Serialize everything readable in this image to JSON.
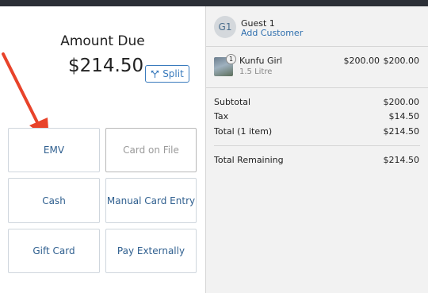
{
  "payment": {
    "amount_due_label": "Amount Due",
    "amount_due_value": "$214.50",
    "split_label": "Split",
    "methods": [
      {
        "label": "EMV",
        "enabled": true
      },
      {
        "label": "Card on File",
        "enabled": false
      },
      {
        "label": "Cash",
        "enabled": true
      },
      {
        "label": "Manual Card Entry",
        "enabled": true
      },
      {
        "label": "Gift Card",
        "enabled": true
      },
      {
        "label": "Pay Externally",
        "enabled": true
      }
    ]
  },
  "guest": {
    "initials": "G1",
    "name": "Guest 1",
    "add_customer": "Add Customer"
  },
  "cart": {
    "items": [
      {
        "qty": "1",
        "name": "Kunfu Girl",
        "variant": "1.5 Litre",
        "unit_price": "$200.00",
        "line_total": "$200.00"
      }
    ]
  },
  "summary": {
    "subtotal_label": "Subtotal",
    "subtotal_value": "$200.00",
    "tax_label": "Tax",
    "tax_value": "$14.50",
    "total_label": "Total (1 item)",
    "total_value": "$214.50",
    "remaining_label": "Total Remaining",
    "remaining_value": "$214.50"
  },
  "colors": {
    "accent": "#3a7bbd",
    "arrow": "#e8432a"
  }
}
